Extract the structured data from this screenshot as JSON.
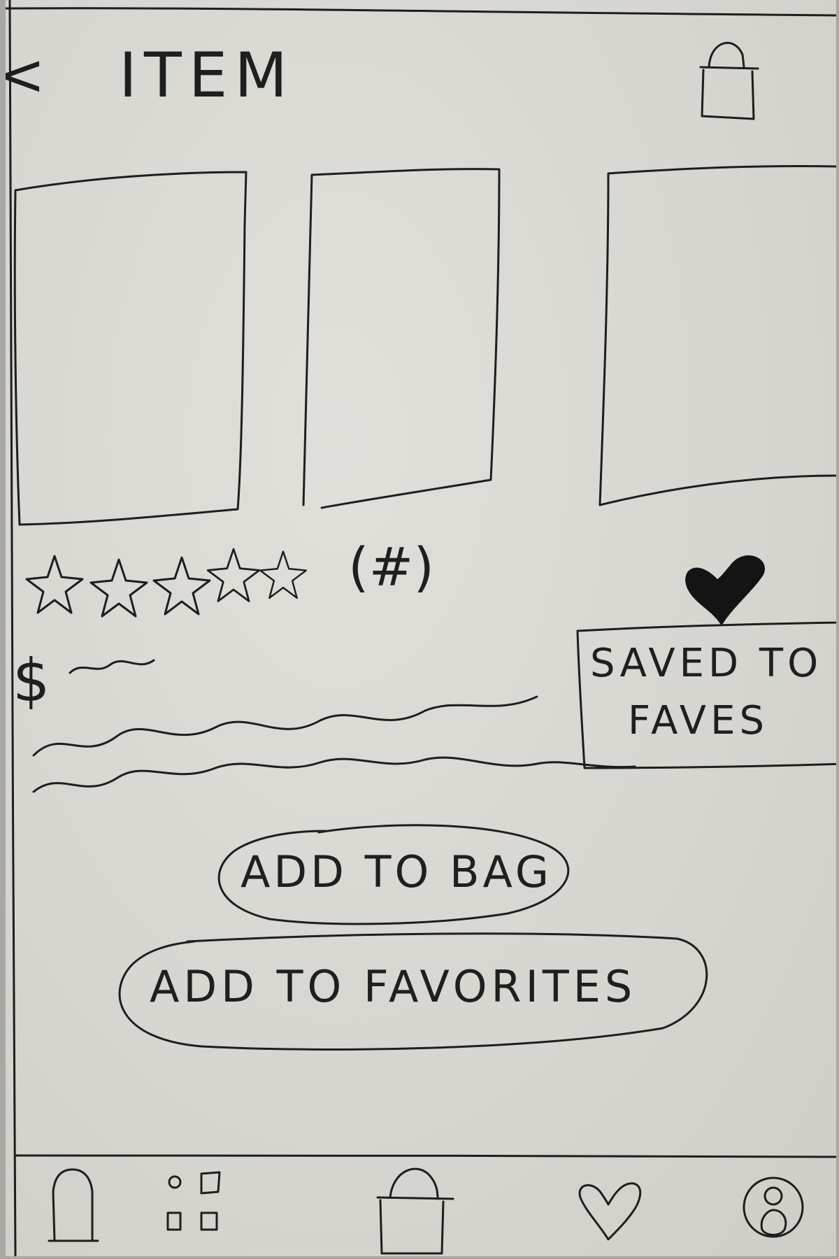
{
  "header": {
    "back_glyph": "<",
    "title": "ITEM",
    "icons": {
      "back": "chevron-left-icon",
      "bag": "shopping-bag-icon"
    }
  },
  "product": {
    "images": [
      {
        "name": "product-image-1"
      },
      {
        "name": "product-image-2"
      },
      {
        "name": "product-image-3"
      }
    ],
    "rating": {
      "stars_total": 5,
      "stars_filled": 0,
      "count_label": "(#)"
    },
    "price_label": "$",
    "saved_toast": {
      "line1": "SAVED TO",
      "line2": "FAVES"
    },
    "favorite_icon": "heart-icon-filled"
  },
  "actions": {
    "add_to_bag": "ADD TO BAG",
    "add_to_favorites": "ADD TO FAVORITES"
  },
  "bottom_nav": {
    "items": [
      {
        "name": "home",
        "icon": "home-icon"
      },
      {
        "name": "categories",
        "icon": "grid-icon"
      },
      {
        "name": "bag",
        "icon": "shopping-bag-icon"
      },
      {
        "name": "favorites",
        "icon": "heart-icon"
      },
      {
        "name": "profile",
        "icon": "profile-icon"
      }
    ]
  }
}
